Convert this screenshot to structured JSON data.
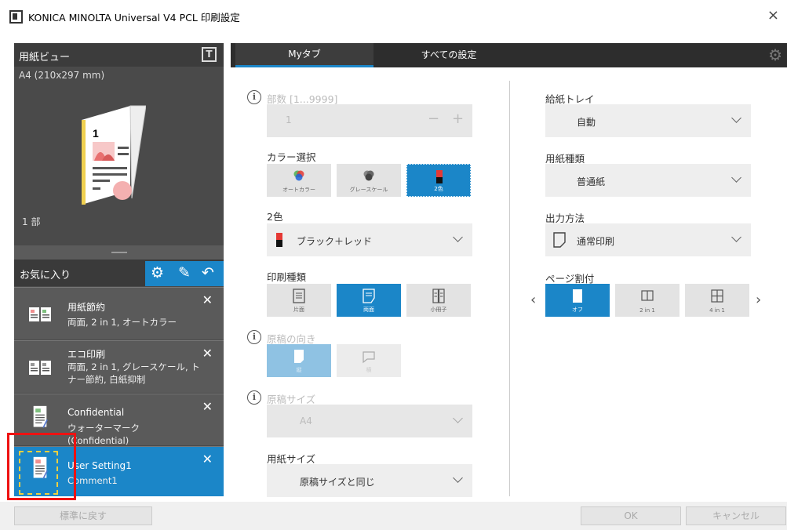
{
  "window": {
    "title": "KONICA MINOLTA Universal V4 PCL 印刷設定",
    "close": "×"
  },
  "preview": {
    "title": "用紙ビュー",
    "t_icon": "T",
    "paper_size": "A4 (210x297 mm)",
    "copies": "1 部",
    "page_number": "1"
  },
  "favorites": {
    "title": "お気に入り",
    "items": [
      {
        "name": "用紙節約",
        "desc": "両面, 2 in 1, オートカラー"
      },
      {
        "name": "エコ印刷",
        "desc": "両面, 2 in 1, グレースケール, トナー節約, 白紙抑制"
      },
      {
        "name": "Confidential",
        "desc": "ウォーターマーク (Confidential)"
      },
      {
        "name": "User Setting1",
        "desc": "Comment1"
      }
    ]
  },
  "tabs": {
    "my": "Myタブ",
    "all": "すべての設定"
  },
  "copies": {
    "label": "部数 [1...9999]",
    "value": "1",
    "minus": "−",
    "plus": "+"
  },
  "color": {
    "label": "カラー選択",
    "options": [
      "オートカラー",
      "グレースケール",
      "2色"
    ],
    "selected": 2
  },
  "two_color": {
    "label": "2色",
    "value": "ブラック＋レッド"
  },
  "print_type": {
    "label": "印刷種類",
    "options": [
      "片面",
      "両面",
      "小冊子"
    ],
    "selected": 1
  },
  "orientation": {
    "label": "原稿の向き",
    "options": [
      "縦",
      "横"
    ]
  },
  "original_size": {
    "label": "原稿サイズ",
    "value": "A4"
  },
  "paper_size": {
    "label": "用紙サイズ",
    "value": "原稿サイズと同じ"
  },
  "tray": {
    "label": "給紙トレイ",
    "value": "自動"
  },
  "paper_type": {
    "label": "用紙種類",
    "value": "普通紙"
  },
  "output": {
    "label": "出力方法",
    "value": "通常印刷"
  },
  "nup": {
    "label": "ページ割付",
    "options": [
      "オフ",
      "2 in 1",
      "4 in 1"
    ],
    "selected": 0,
    "prev": "‹",
    "next": "›"
  },
  "footer": {
    "reset": "標準に戻す",
    "ok": "OK",
    "cancel": "キャンセル"
  },
  "colors": {
    "accent": "#1b86c8",
    "panel": "#4a4a4a",
    "highlight": "#e11111"
  }
}
